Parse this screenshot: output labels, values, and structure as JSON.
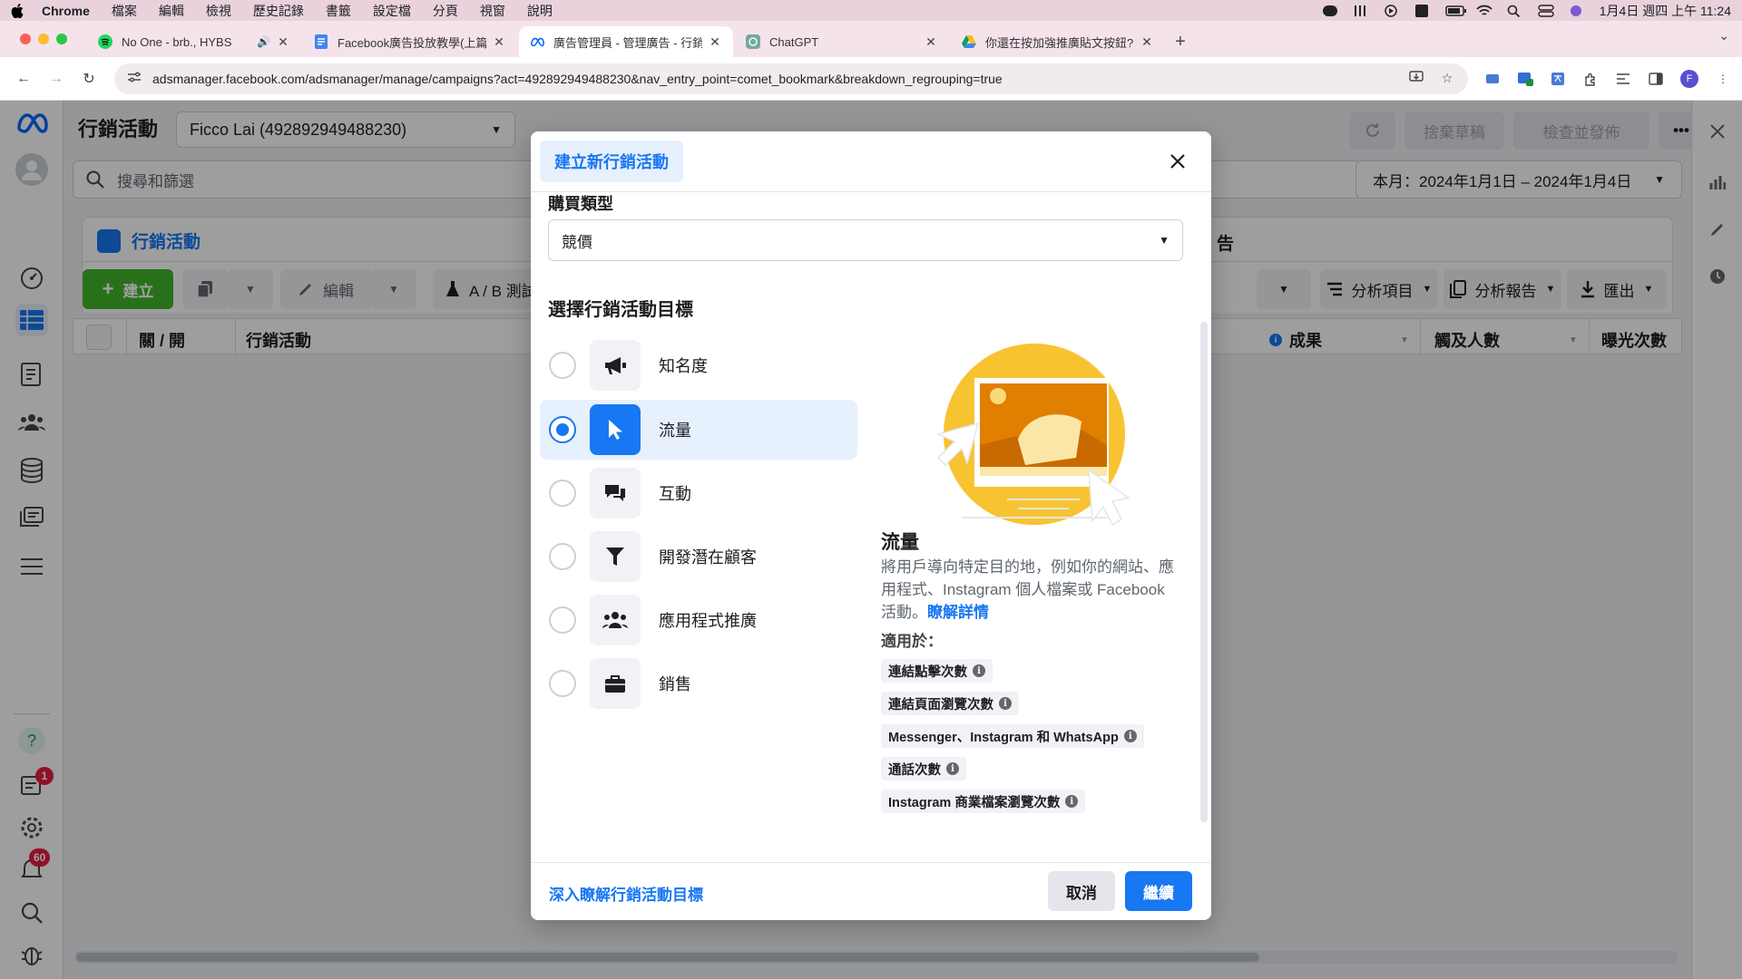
{
  "menubar": {
    "app": "Chrome",
    "items": [
      "檔案",
      "編輯",
      "檢視",
      "歷史記錄",
      "書籤",
      "設定檔",
      "分頁",
      "視窗",
      "說明"
    ],
    "clock": "1月4日 週四 上午 11:24"
  },
  "tabs": [
    {
      "label": "No One - brb., HYBS",
      "icon": "spotify-icon",
      "audio": "🔊"
    },
    {
      "label": "Facebook廣告投放教學(上篇)：",
      "icon": "docs-icon"
    },
    {
      "label": "廣告管理員 - 管理廣告 - 行銷活",
      "icon": "meta-icon"
    },
    {
      "label": "ChatGPT",
      "icon": "chatgpt-icon"
    },
    {
      "label": "你還在按加強推廣貼文按鈕?",
      "icon": "drive-icon"
    }
  ],
  "address": {
    "url": "adsmanager.facebook.com/adsmanager/manage/campaigns?act=492892949488230&nav_entry_point=comet_bookmark&breakdown_regrouping=true",
    "profile_initial": "F"
  },
  "ads": {
    "page_title": "行銷活動",
    "account": "Ficco Lai (492892949488230)",
    "btn_discard": "捨棄草稿",
    "btn_review": "檢查並發佈",
    "search_placeholder": "搜尋和篩選",
    "date_range": "本月：2024年1月1日 – 2024年1月4日",
    "tab_campaigns": "行銷活動",
    "tab_ads_partial": "告",
    "toolbar": {
      "create": "建立",
      "edit": "編輯",
      "ab_test": "A / B 測試",
      "breakdown": "分析項目",
      "reports": "分析報告",
      "export": "匯出"
    },
    "columns": {
      "onoff": "關 / 開",
      "campaign": "行銷活動",
      "results": "成果",
      "reach": "觸及人數",
      "impressions": "曝光次數"
    }
  },
  "leftnav": {
    "badge_notifications": "1",
    "badge_alerts": "60"
  },
  "modal": {
    "title": "建立新行銷活動",
    "buy_type_label": "購買類型",
    "buy_type_value": "競價",
    "objective_heading": "選擇行銷活動目標",
    "objectives": [
      {
        "label": "知名度",
        "icon": "megaphone-icon",
        "selected": false
      },
      {
        "label": "流量",
        "icon": "cursor-icon",
        "selected": true
      },
      {
        "label": "互動",
        "icon": "chat-bubbles-icon",
        "selected": false
      },
      {
        "label": "開發潛在顧客",
        "icon": "filter-icon",
        "selected": false
      },
      {
        "label": "應用程式推廣",
        "icon": "people-icon",
        "selected": false
      },
      {
        "label": "銷售",
        "icon": "briefcase-icon",
        "selected": false
      }
    ],
    "detail_title": "流量",
    "detail_desc": "將用戶導向特定目的地，例如你的網站、應用程式、Instagram 個人檔案或 Facebook 活動。",
    "detail_link": "瞭解詳情",
    "apply_label": "適用於：",
    "chips": [
      "連結點擊次數",
      "連結頁面瀏覽次數",
      "Messenger、Instagram 和 WhatsApp",
      "通話次數",
      "Instagram 商業檔案瀏覽次數"
    ],
    "info_glyph": "i",
    "learn_more": "深入瞭解行銷活動目標",
    "cancel": "取消",
    "continue": "繼續"
  }
}
